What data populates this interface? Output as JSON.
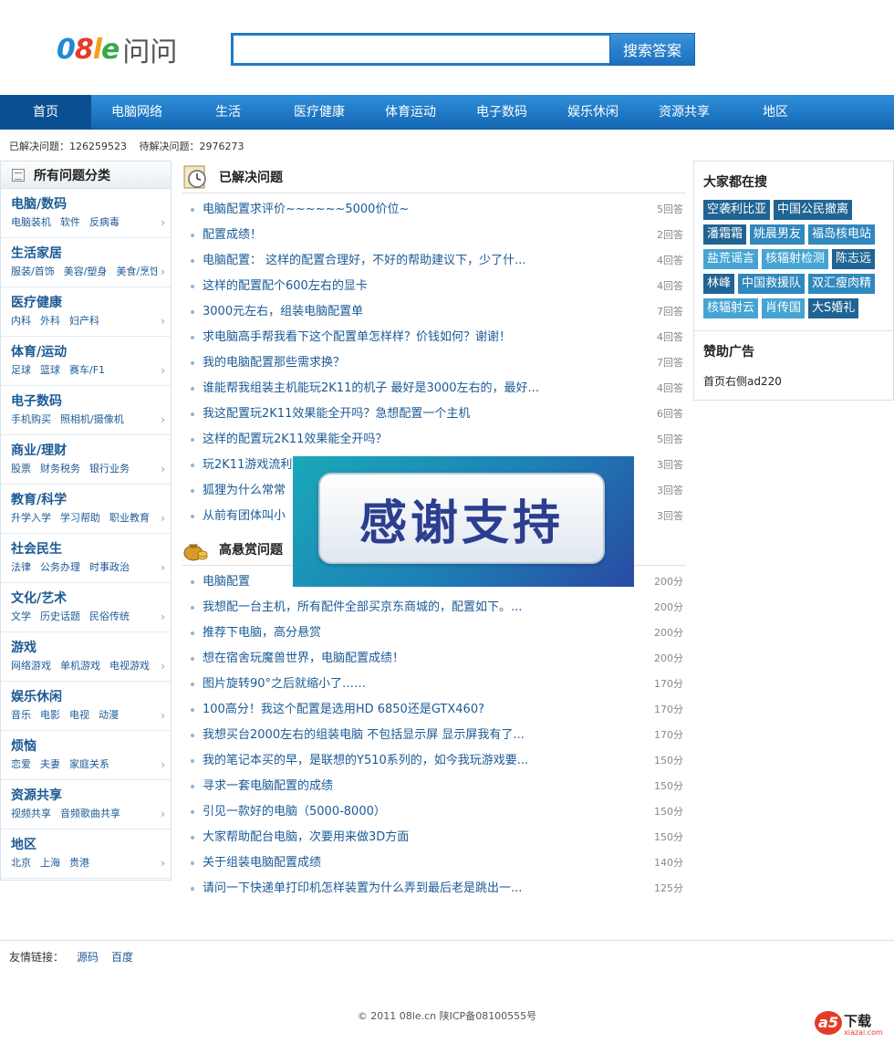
{
  "logo": {
    "brand_parts": [
      "0",
      "8",
      "l",
      "e"
    ],
    "suffix": "问问"
  },
  "search": {
    "value": "",
    "placeholder": "",
    "button_label": "搜索答案"
  },
  "nav": [
    "首页",
    "电脑网络",
    "生活",
    "医疗健康",
    "体育运动",
    "电子数码",
    "娱乐休闲",
    "资源共享",
    "地区"
  ],
  "stats": {
    "solved": "已解决问题：126259523",
    "pending": "待解决问题：2976273"
  },
  "sidebar": {
    "title": "所有问题分类",
    "categories": [
      {
        "title": "电脑/数码",
        "subs": [
          "电脑装机",
          "软件",
          "反病毒"
        ]
      },
      {
        "title": "生活家居",
        "subs": [
          "服装/首饰",
          "美容/塑身",
          "美食/烹饪"
        ]
      },
      {
        "title": "医疗健康",
        "subs": [
          "内科",
          "外科",
          "妇产科"
        ]
      },
      {
        "title": "体育/运动",
        "subs": [
          "足球",
          "篮球",
          "赛车/F1"
        ]
      },
      {
        "title": "电子数码",
        "subs": [
          "手机购买",
          "照相机/摄像机"
        ]
      },
      {
        "title": "商业/理财",
        "subs": [
          "股票",
          "财务税务",
          "银行业务"
        ]
      },
      {
        "title": "教育/科学",
        "subs": [
          "升学入学",
          "学习帮助",
          "职业教育"
        ]
      },
      {
        "title": "社会民生",
        "subs": [
          "法律",
          "公务办理",
          "时事政治"
        ]
      },
      {
        "title": "文化/艺术",
        "subs": [
          "文学",
          "历史话题",
          "民俗传统"
        ]
      },
      {
        "title": "游戏",
        "subs": [
          "网络游戏",
          "单机游戏",
          "电视游戏"
        ]
      },
      {
        "title": "娱乐休闲",
        "subs": [
          "音乐",
          "电影",
          "电视",
          "动漫"
        ]
      },
      {
        "title": "烦恼",
        "subs": [
          "恋爱",
          "夫妻",
          "家庭关系"
        ]
      },
      {
        "title": "资源共享",
        "subs": [
          "视频共享",
          "音频歌曲共享"
        ]
      },
      {
        "title": "地区",
        "subs": [
          "北京",
          "上海",
          "贵港"
        ]
      }
    ]
  },
  "solved": {
    "title": "已解决问题",
    "items": [
      {
        "title": "电脑配置求评价~~~~~~5000价位~",
        "meta": "5回答"
      },
      {
        "title": "配置成绩！",
        "meta": "2回答"
      },
      {
        "title": "电脑配置： 这样的配置合理好，不好的帮助建议下，少了什...",
        "meta": "4回答"
      },
      {
        "title": "这样的配置配个600左右的显卡",
        "meta": "4回答"
      },
      {
        "title": "3000元左右，组装电脑配置单",
        "meta": "7回答"
      },
      {
        "title": "求电脑高手帮我看下这个配置单怎样样？价钱如何？谢谢！",
        "meta": "4回答"
      },
      {
        "title": "我的电脑配置那些需求换？",
        "meta": "7回答"
      },
      {
        "title": "谁能帮我组装主机能玩2K11的机子 最好是3000左右的，最好...",
        "meta": "4回答"
      },
      {
        "title": "我这配置玩2K11效果能全开吗？急想配置一个主机",
        "meta": "6回答"
      },
      {
        "title": "这样的配置玩2K11效果能全开吗？",
        "meta": "5回答"
      },
      {
        "title": "玩2K11游戏流利",
        "meta": "3回答"
      },
      {
        "title": "狐狸为什么常常",
        "meta": "3回答"
      },
      {
        "title": "从前有团体叫小",
        "meta": "3回答"
      }
    ]
  },
  "reward": {
    "title": "高悬赏问题",
    "items": [
      {
        "title": "电脑配置",
        "meta": "200分"
      },
      {
        "title": "我想配一台主机，所有配件全部买京东商城的，配置如下。...",
        "meta": "200分"
      },
      {
        "title": "推荐下电脑，高分悬赏",
        "meta": "200分"
      },
      {
        "title": "想在宿舍玩魔兽世界，电脑配置成绩！",
        "meta": "200分"
      },
      {
        "title": "图片旋转90°之后就缩小了……",
        "meta": "170分"
      },
      {
        "title": "100高分！我这个配置是选用HD 6850还是GTX460?",
        "meta": "170分"
      },
      {
        "title": "我想买台2000左右的组装电脑 不包括显示屏 显示屏我有了...",
        "meta": "170分"
      },
      {
        "title": "我的笔记本买的早，是联想的Y510系列的，如今我玩游戏要...",
        "meta": "150分"
      },
      {
        "title": "寻求一套电脑配置的成绩",
        "meta": "150分"
      },
      {
        "title": "引见一款好的电脑（5000-8000）",
        "meta": "150分"
      },
      {
        "title": "大家帮助配台电脑，次要用来做3D方面",
        "meta": "150分"
      },
      {
        "title": "关于组装电脑配置成绩",
        "meta": "140分"
      },
      {
        "title": "请问一下快递单打印机怎样装置为什么弄到最后老是跳出一...",
        "meta": "125分"
      }
    ]
  },
  "banner": {
    "text": "感谢支持"
  },
  "right": {
    "hot_title": "大家都在搜",
    "tags": [
      {
        "label": "空袭利比亚",
        "tone": "c0"
      },
      {
        "label": "中国公民撤离",
        "tone": "c0"
      },
      {
        "label": "潘霜霜",
        "tone": "c0"
      },
      {
        "label": "姚晨男友",
        "tone": "c1"
      },
      {
        "label": "福岛核电站",
        "tone": "c1"
      },
      {
        "label": "盐荒谣言",
        "tone": "c2"
      },
      {
        "label": "核辐射检测",
        "tone": "c2"
      },
      {
        "label": "陈志远",
        "tone": "c0"
      },
      {
        "label": "林峰",
        "tone": "c0"
      },
      {
        "label": "中国救援队",
        "tone": "c1"
      },
      {
        "label": "双汇瘦肉精",
        "tone": "c1"
      },
      {
        "label": "核辐射云",
        "tone": "c2"
      },
      {
        "label": "肖传国",
        "tone": "c2"
      },
      {
        "label": "大S婚礼",
        "tone": "c0"
      }
    ],
    "ad_title": "赞助广告",
    "ad_text": "首页右侧ad220"
  },
  "footer": {
    "friend_label": "友情链接：",
    "links": [
      "源码",
      "百度"
    ],
    "copyright": "© 2011 08le.cn 陕ICP备08100555号"
  },
  "watermark": {
    "badge": "a5",
    "text": "下载",
    "domain": "xiazai.com"
  }
}
